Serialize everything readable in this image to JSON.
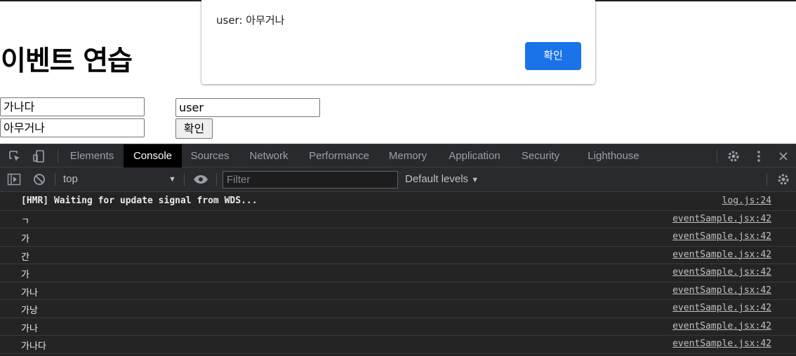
{
  "page": {
    "title": "이벤트 연습",
    "inputs": [
      "가나다",
      "아무거나",
      "user"
    ],
    "button_label": "확인"
  },
  "alert": {
    "message": "user: 아무거나",
    "ok_label": "확인",
    "accent": "#1a73e8"
  },
  "devtools": {
    "tabs": [
      "Elements",
      "Console",
      "Sources",
      "Network",
      "Performance",
      "Memory",
      "Application",
      "Security",
      "Lighthouse"
    ],
    "active_tab": "Console",
    "context": "top",
    "filter_placeholder": "Filter",
    "levels": "Default levels",
    "logs": [
      {
        "message": "[HMR] Waiting for update signal from WDS...",
        "source": "log.js:24"
      },
      {
        "message": "ㄱ",
        "source": "eventSample.jsx:42"
      },
      {
        "message": "가",
        "source": "eventSample.jsx:42"
      },
      {
        "message": "간",
        "source": "eventSample.jsx:42"
      },
      {
        "message": "가",
        "source": "eventSample.jsx:42"
      },
      {
        "message": "가나",
        "source": "eventSample.jsx:42"
      },
      {
        "message": "가낭",
        "source": "eventSample.jsx:42"
      },
      {
        "message": "가나",
        "source": "eventSample.jsx:42"
      },
      {
        "message": "가나다",
        "source": "eventSample.jsx:42"
      }
    ]
  }
}
